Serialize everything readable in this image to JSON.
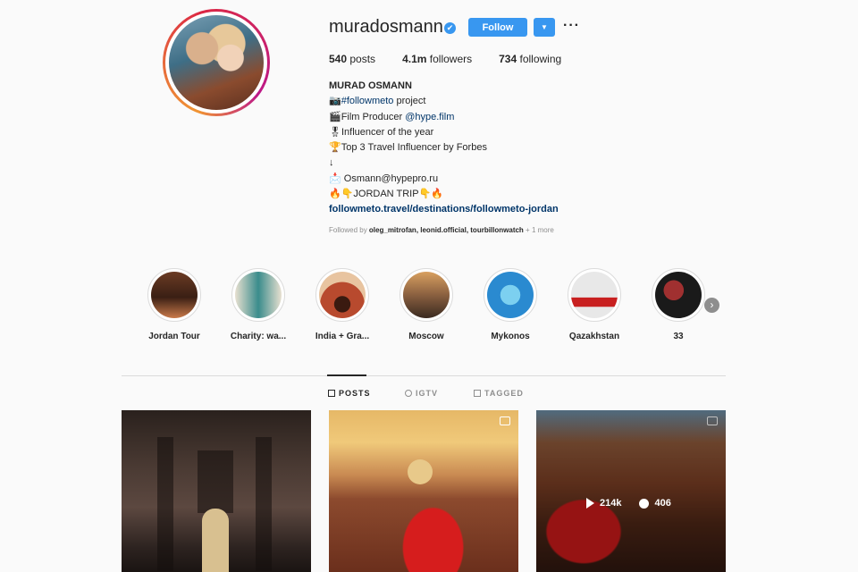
{
  "profile": {
    "username": "muradosmann",
    "verified_mark": "✔",
    "follow_label": "Follow",
    "dropdown_glyph": "▼",
    "more_glyph": "···",
    "stats": {
      "posts_value": "540",
      "posts_label": "posts",
      "followers_value": "4.1m",
      "followers_label": "followers",
      "following_value": "734",
      "following_label": "following"
    },
    "bio": {
      "full_name": "MURAD OSMANN",
      "line1_emoji": "📷",
      "line1_tag": "#followmeto",
      "line1_text": " project",
      "line2_emoji": "🎬",
      "line2_text": "Film Producer ",
      "line2_link": "@hype.film",
      "line3_emoji": "🎖",
      "line3_text": "Influencer of the year",
      "line4_emoji": "🏆",
      "line4_text": "Top 3 Travel Influencer by Forbes",
      "line5_text": "↓",
      "line6_emoji": "📩",
      "line6_text": " Osmann@hypepro.ru",
      "line7_text": "🔥👇JORDAN TRIP👇🔥",
      "url": "followmeto.travel/destinations/followmeto-jordan"
    },
    "followed_by": {
      "prefix": "Followed by ",
      "users": "oleg_mitrofan, leonid.official, tourbillonwatch",
      "suffix": " + 1 more"
    }
  },
  "highlights": [
    {
      "label": "Jordan Tour",
      "color_a": "#6b3b24",
      "color_b": "#c97a4a"
    },
    {
      "label": "Charity: wa...",
      "color_a": "#3a8c8c",
      "color_b": "#e8e0d0"
    },
    {
      "label": "India + Gra...",
      "color_a": "#b84a2e",
      "color_b": "#e8c4a0"
    },
    {
      "label": "Moscow",
      "color_a": "#5a4030",
      "color_b": "#d8a060"
    },
    {
      "label": "Mykonos",
      "color_a": "#2a8ad0",
      "color_b": "#7cd0f0"
    },
    {
      "label": "Qazakhstan",
      "color_a": "#e8e8e8",
      "color_b": "#c82020"
    },
    {
      "label": "33",
      "color_a": "#1a1a1a",
      "color_b": "#a03030"
    }
  ],
  "next_glyph": "›",
  "tabs": [
    {
      "label": "POSTS",
      "active": true
    },
    {
      "label": "IGTV",
      "active": false
    },
    {
      "label": "TAGGED",
      "active": false
    }
  ],
  "posts": [
    {
      "has_video": false
    },
    {
      "has_video": true
    },
    {
      "has_video": true,
      "hovered": true,
      "views": "214k",
      "comments": "406"
    }
  ]
}
